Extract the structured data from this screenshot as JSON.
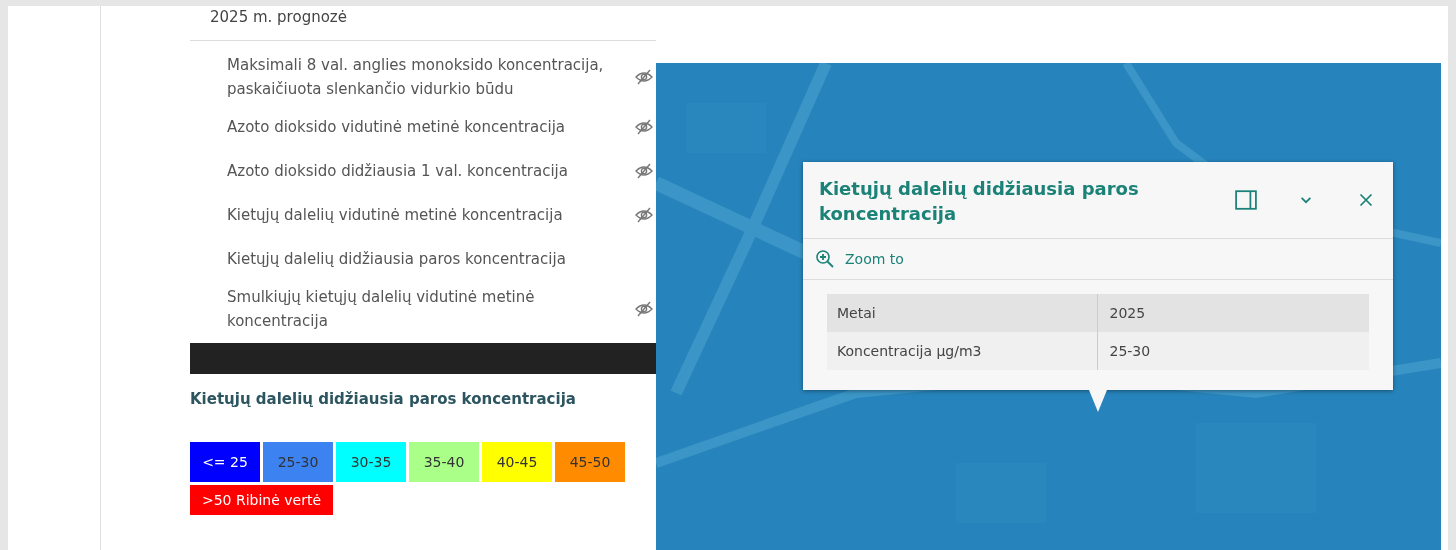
{
  "layer_list": {
    "heading": "2025 m. prognozė",
    "layers": [
      {
        "label": "Maksimali 8 val. anglies monoksido koncentracija, paskaičiuota slenkančio vidurkio būdu",
        "visible": false
      },
      {
        "label": "Azoto dioksido vidutinė metinė koncentracija",
        "visible": false
      },
      {
        "label": "Azoto dioksido didžiausia 1 val. koncentracija",
        "visible": false
      },
      {
        "label": "Kietųjų dalelių vidutinė metinė koncentracija",
        "visible": false
      },
      {
        "label": "Kietųjų dalelių didžiausia paros koncentracija",
        "visible": true
      },
      {
        "label": "Smulkiųjų kietųjų dalelių vidutinė metinė koncentracija",
        "visible": false
      }
    ]
  },
  "legend": {
    "title": "Kietųjų dalelių didžiausia paros koncentracija",
    "items": [
      {
        "label": "<= 25",
        "color": "#0000ff"
      },
      {
        "label": "25-30",
        "color": "#3c82f0"
      },
      {
        "label": "30-35",
        "color": "#00ffff"
      },
      {
        "label": "35-40",
        "color": "#aaff88"
      },
      {
        "label": "40-45",
        "color": "#ffff00"
      },
      {
        "label": "45-50",
        "color": "#ff8c00"
      },
      {
        "label": ">50 Ribinė vertė",
        "color": "#ff0000"
      }
    ]
  },
  "popup": {
    "title": "Kietųjų dalelių didžiausia paros koncentracija",
    "zoom_action": "Zoom to",
    "rows": [
      {
        "field": "Metai",
        "value": "2025"
      },
      {
        "field": "Koncentracija µg/m3",
        "value": "25-30"
      }
    ]
  }
}
